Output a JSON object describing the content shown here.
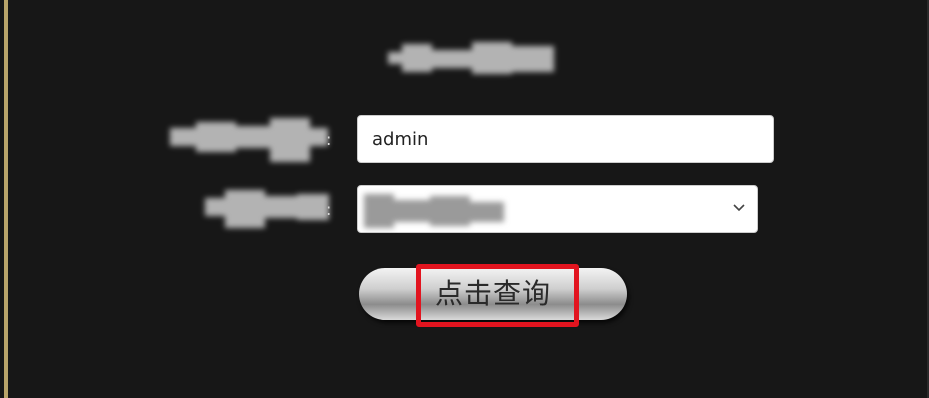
{
  "form": {
    "username": {
      "value": "admin"
    },
    "select": {
      "chevron_icon": "chevron-down-icon"
    },
    "submit_label": "点击查询"
  },
  "annotation": {
    "highlight_color": "#e2141f"
  }
}
